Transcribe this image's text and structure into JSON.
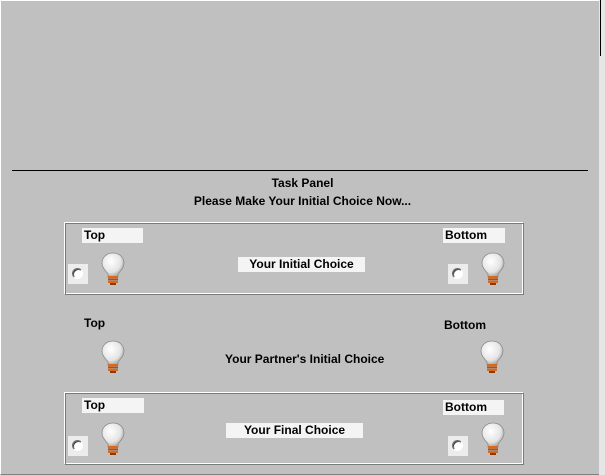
{
  "task_panel": {
    "title": "Task Panel",
    "instruction": "Please Make Your Initial Choice Now..."
  },
  "initial_choice": {
    "top_label": "Top",
    "bottom_label": "Bottom",
    "center_label": "Your Initial Choice",
    "top_selected": false,
    "bottom_selected": false
  },
  "partner_choice": {
    "top_label": "Top",
    "bottom_label": "Bottom",
    "center_label": "Your Partner's Initial Choice"
  },
  "final_choice": {
    "top_label": "Top",
    "bottom_label": "Bottom",
    "center_label": "Your Final Choice",
    "top_selected": false,
    "bottom_selected": false
  },
  "icons": {
    "bulb": "light-bulb-icon",
    "radio": "radio-button"
  },
  "colors": {
    "background": "#c0c0c0",
    "bulb_glass": "#e8e8e8",
    "bulb_base": "#d2691e"
  }
}
